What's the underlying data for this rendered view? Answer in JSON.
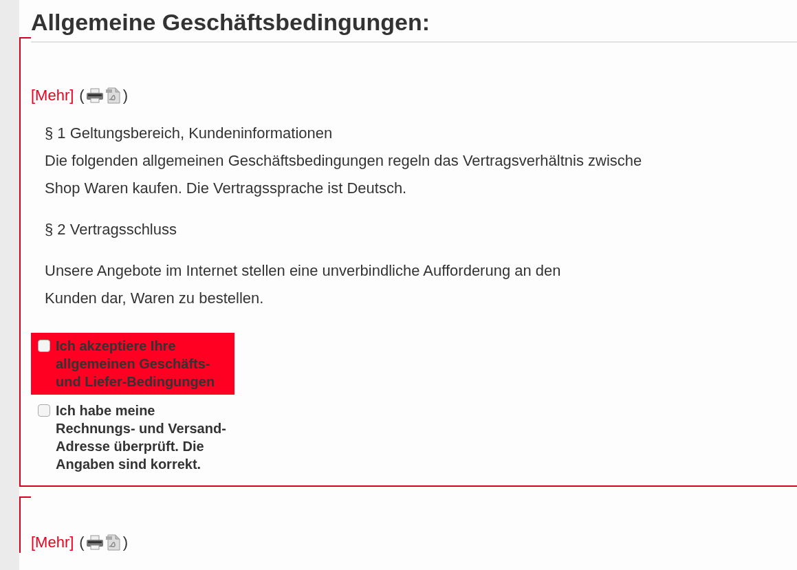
{
  "heading": "Allgemeine Geschäftsbedingungen:",
  "sections": [
    {
      "more_link": "[Mehr]",
      "paren_open": "(",
      "paren_close": ")",
      "paragraphs": [
        {
          "lines": [
            "§ 1 Geltungsbereich, Kundeninformationen",
            "Die folgenden allgemeinen Geschäftsbedingungen regeln das Vertragsverhältnis zwische",
            "Shop Waren kaufen. Die Vertragssprache ist Deutsch."
          ]
        },
        {
          "lines": [
            "§ 2 Vertragsschluss"
          ]
        },
        {
          "lines": [
            "Unsere Angebote im Internet stellen eine unverbindliche Aufforderung an den",
            "Kunden dar, Waren zu bestellen."
          ]
        }
      ],
      "checkboxes": [
        {
          "label": "Ich akzeptiere Ihre allgemeinen Geschäfts- und Liefer-Bedingungen",
          "checked": false,
          "highlighted": true
        },
        {
          "label": "Ich habe meine Rechnungs- und Versand-Adresse überprüft. Die Angaben sind korrekt.",
          "checked": false,
          "highlighted": false
        }
      ]
    },
    {
      "more_link": "[Mehr]",
      "paren_open": "(",
      "paren_close": ")"
    }
  ]
}
